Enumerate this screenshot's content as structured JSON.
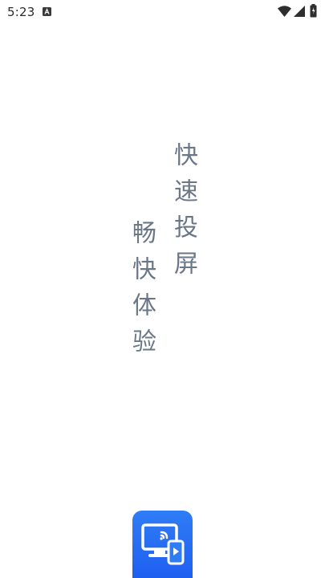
{
  "status_bar": {
    "time": "5:23",
    "icons": [
      "notification-a-icon",
      "wifi-icon",
      "signal-icon",
      "battery-icon"
    ]
  },
  "splash": {
    "slogan_line_1": "快速投屏",
    "slogan_line_2": "畅快体验",
    "text_color": "#6b7787"
  },
  "app_icon": {
    "name": "screen-cast-app-icon",
    "background_color": "#2f7df6"
  }
}
